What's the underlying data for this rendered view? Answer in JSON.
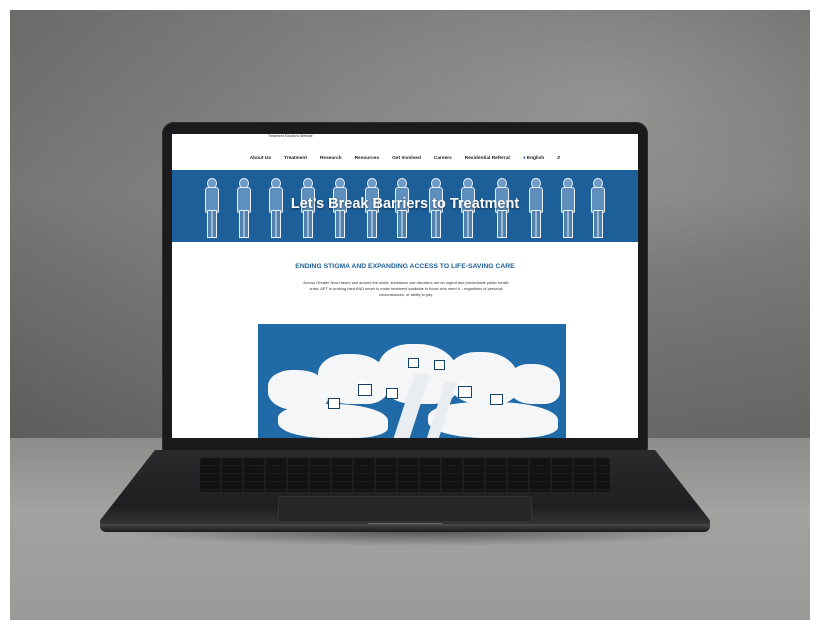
{
  "website": {
    "top_text": "Treatment Solutions Website",
    "nav": {
      "items": [
        "About Us",
        "Treatment",
        "Research",
        "Resources",
        "Get Involved",
        "Careers",
        "Residential Referral"
      ],
      "language": "English",
      "search_icon": "search-icon"
    },
    "hero": {
      "title": "Let’s Break Barriers to Treatment"
    },
    "section": {
      "heading": "ENDING STIGMA AND EXPANDING ACCESS TO LIFE-SAVING CARE",
      "intro": "Across Greater New Haven and around the world, substance use disorders are an urgent and preventable public health crisis. APT is working hard AND smart to make treatment available to those who need it – regardless of personal circumstances, or ability to pay."
    }
  },
  "colors": {
    "brand_blue": "#1d5f99",
    "heading_blue": "#1d5f99"
  }
}
